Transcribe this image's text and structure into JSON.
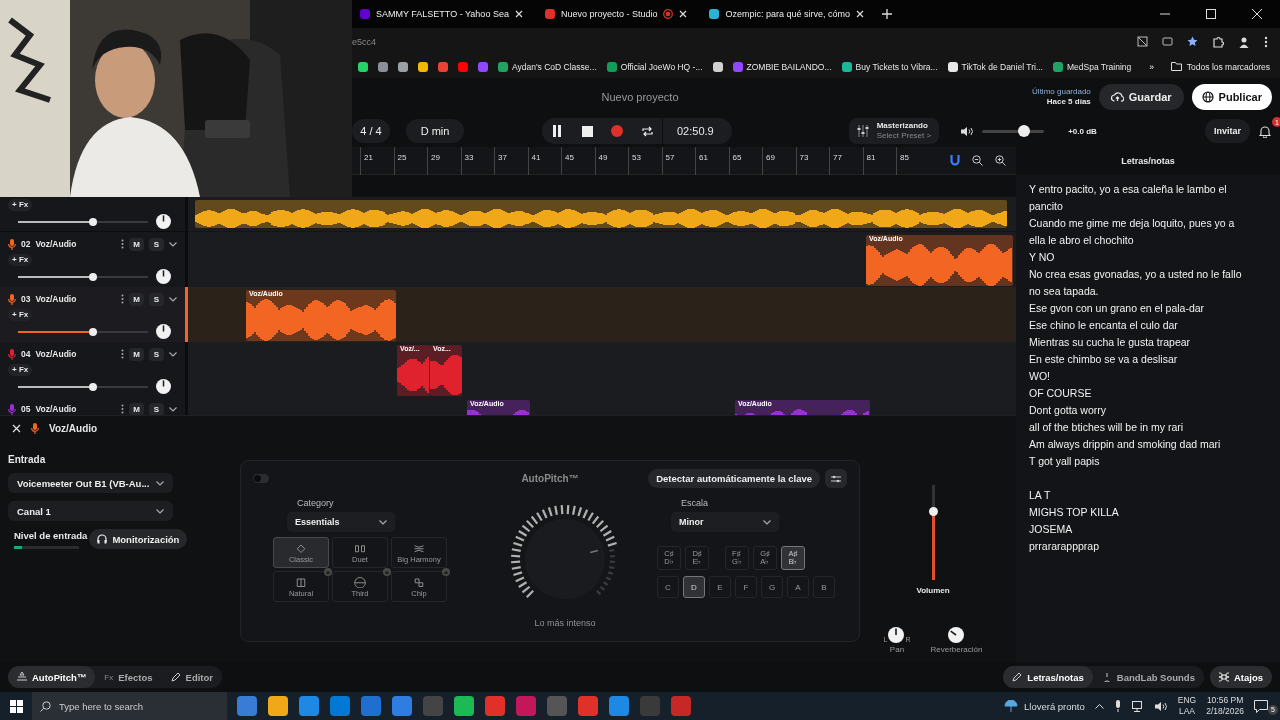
{
  "browser": {
    "tabs": [
      {
        "title": "SAMMY FALSETTO - Yahoo Sea",
        "color": "#6001d2",
        "recording": false
      },
      {
        "title": "Nuevo proyecto - Studio",
        "color": "#e0302a",
        "recording": true
      },
      {
        "title": "Ozempic: para qué sirve, cómo",
        "color": "#2bb3d6",
        "recording": false
      }
    ],
    "address": "e5cc4",
    "bookmarks": [
      {
        "color": "#25d366"
      },
      {
        "color": "#8a8f98"
      },
      {
        "color": "#9aa0a6"
      },
      {
        "color": "#f5b800"
      },
      {
        "color": "#ea4335"
      },
      {
        "color": "#ff0000"
      },
      {
        "color": "#9146ff"
      },
      {
        "label": "Aydan's CoD Classe...",
        "color": "#1fa463"
      },
      {
        "label": "Official JoeWo HQ -...",
        "color": "#0f9d58"
      },
      {
        "color": "#d0d0d0"
      },
      {
        "label": "ZOMBIE BAILANDO...",
        "color": "#9146ff"
      },
      {
        "label": "Buy Tickets to Vibra...",
        "color": "#1bb79a"
      },
      {
        "label": "TikTok de Daniel Tri...",
        "color": "#e8e8e8"
      },
      {
        "label": "MedSpa Training",
        "color": "#1fa463"
      }
    ],
    "more": "»",
    "all_bookmarks": "Todos los marcadores"
  },
  "project": {
    "title": "Nuevo proyecto",
    "last_saved_label": "Último guardado",
    "last_saved": "Hace 5 días",
    "save": "Guardar",
    "publish": "Publicar"
  },
  "transport": {
    "time_signature": "4 / 4",
    "key": "D min",
    "playing": true,
    "time": "02:50.9",
    "mastering": {
      "title": "Masterizando",
      "preset": "Select Preset >"
    },
    "master_volume": {
      "level": 0.68
    },
    "gain": "+0.0 dB",
    "invite": "Invitar",
    "notifications": "1"
  },
  "ruler": {
    "bars": [
      "21",
      "25",
      "29",
      "33",
      "37",
      "41",
      "45",
      "49",
      "53",
      "57",
      "61",
      "65",
      "69",
      "73",
      "77",
      "81",
      "85"
    ],
    "snap": true
  },
  "tracks": [
    {
      "fx": "+ Fx",
      "level": 0.58,
      "pan": {
        "level": 0.5
      },
      "selected": false,
      "color": "#f0a818",
      "clips": [
        {
          "kind": "audio"
        }
      ]
    },
    {
      "number": "02",
      "name": "Voz/Audio",
      "mute": "M",
      "solo": "S",
      "fx": "+ Fx",
      "level": 0.58,
      "pan": {
        "level": 0.5
      },
      "selected": false,
      "color": "#f26522",
      "clips": [
        {
          "kind": "audio",
          "label": "Voz/Audio"
        }
      ]
    },
    {
      "number": "03",
      "name": "Voz/Audio",
      "mute": "M",
      "solo": "S",
      "fx": "+ Fx",
      "level": 0.58,
      "pan": {
        "level": 0.5
      },
      "selected": true,
      "color": "#f26522",
      "clips": [
        {
          "kind": "audio",
          "label": "Voz/Audio"
        }
      ]
    },
    {
      "number": "04",
      "name": "Voz/Audio",
      "mute": "M",
      "solo": "S",
      "fx": "+ Fx",
      "level": 0.58,
      "pan": {
        "level": 0.5
      },
      "selected": false,
      "color": "#e0222e",
      "clips": [
        {
          "kind": "audio",
          "label": "Voz/..."
        },
        {
          "kind": "audio",
          "label": "Voz..."
        }
      ]
    },
    {
      "number": "05",
      "name": "Voz/Audio",
      "mute": "M",
      "solo": "S",
      "selected": false,
      "color": "#9b2fd6",
      "clips": [
        {
          "kind": "audio",
          "label": "Voz/Audio"
        },
        {
          "kind": "audio",
          "label": "Voz/Audio"
        }
      ]
    }
  ],
  "editor": {
    "track_name": "Voz/Audio",
    "input_label": "Entrada",
    "input_device": "Voicemeeter Out B1 (VB-Au...",
    "channel": "Canal 1",
    "input_level_label": "Nivel de entrada",
    "input_level": {
      "level": 0.12
    },
    "monitoring": "Monitorización"
  },
  "autopitch": {
    "on": false,
    "title": "AutoPitch™",
    "detect_key": "Detectar automáticamente la clave",
    "category_label": "Category",
    "category": "Essentials",
    "presets": [
      {
        "label": "Classic",
        "selected": true,
        "locked": false
      },
      {
        "label": "Duet",
        "selected": false,
        "locked": false
      },
      {
        "label": "Big Harmony",
        "selected": false,
        "locked": false
      },
      {
        "label": "Natural",
        "selected": false,
        "locked": true
      },
      {
        "label": "Third",
        "selected": false,
        "locked": true
      },
      {
        "label": "Chip",
        "selected": false,
        "locked": true
      }
    ],
    "strength_label": "Lo más intenso",
    "strength": {
      "level": 0.78
    },
    "scale_label": "Escala",
    "scale": "Minor",
    "sharps": [
      {
        "top": "C♯",
        "bottom": "D♭",
        "selected": false
      },
      {
        "top": "D♯",
        "bottom": "E♭",
        "selected": false
      },
      {
        "top": "F♯",
        "bottom": "G♭",
        "selected": false
      },
      {
        "top": "G♯",
        "bottom": "A♭",
        "selected": false
      },
      {
        "top": "A♯",
        "bottom": "B♭",
        "selected": true
      }
    ],
    "naturals": [
      {
        "label": "C",
        "selected": false
      },
      {
        "label": "D",
        "selected": true
      },
      {
        "label": "E",
        "selected": false
      },
      {
        "label": "F",
        "selected": false
      },
      {
        "label": "G",
        "selected": false
      },
      {
        "label": "A",
        "selected": false
      },
      {
        "label": "B",
        "selected": false
      }
    ]
  },
  "mixer": {
    "volume": {
      "level": 0.72
    },
    "volume_label": "Volumen",
    "pan": {
      "level": 0.5
    },
    "pan_left": "L",
    "pan_right": "R",
    "pan_label": "Pan",
    "reverb": {
      "level": 0.3
    },
    "reverb_label": "Reverberación"
  },
  "lyrics": {
    "title": "Letras/notas",
    "stanzas": [
      [
        "Y entro pacito, yo a esa caleña le lambo el pancito",
        "Cuando me gime me deja loquito, pues yo a ella le abro el chochito",
        "Y NO",
        "No crea esas gvonadas, yo a usted no le fallo no sea tapada.",
        "Ese gvon con un grano en el pala-dar",
        "Ese chino le encanta el culo dar",
        "Mientras su cucha le gusta trapear",
        "En este chimbo se va a deslisar",
        "WO!",
        "OF COURSE",
        "Dont gotta worry",
        "all of the btiches will be in my rari",
        "Am always drippin and smoking dad mari",
        "T got yall papis"
      ],
      [
        "LA T",
        "MIGHS TOP KILLA",
        "JOSEMA",
        "prrararappprap"
      ]
    ]
  },
  "editor_tabs": [
    {
      "label": "AutoPitch™",
      "selected": true
    },
    {
      "icon_text": "Fx",
      "label": "Efectos",
      "selected": false
    },
    {
      "label": "Editor",
      "selected": false
    }
  ],
  "side_tabs": [
    {
      "label": "Letras/notas",
      "selected": true
    },
    {
      "label": "BandLab Sounds",
      "selected": false
    }
  ],
  "shortcuts": "Atajos",
  "taskbar": {
    "search": "Type here to search",
    "weather": "Lloverá pronto",
    "lang": "ENG",
    "layout": "LAA",
    "time": "10:56 PM",
    "date": "2/18/2026",
    "notifications": "5"
  }
}
